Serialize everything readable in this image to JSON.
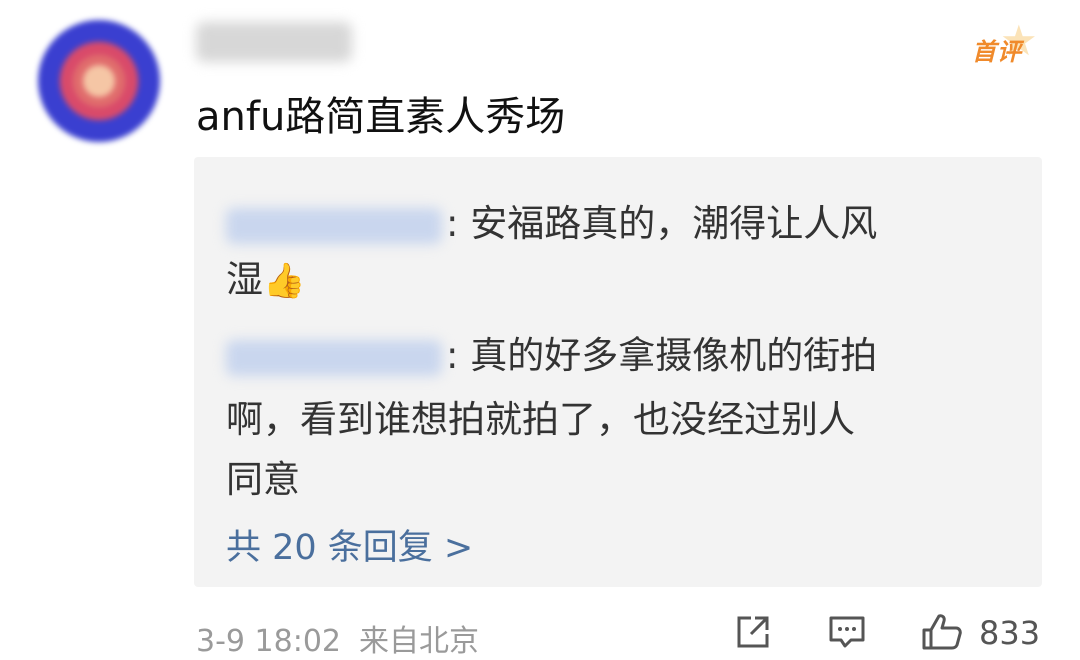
{
  "post": {
    "badge": "首评",
    "content": "anfu路简直素人秀场"
  },
  "replies": [
    {
      "text_line1": ": 安福路真的，潮得让人风",
      "text_line2": "湿",
      "emoji": "👍"
    },
    {
      "text_line1": ": 真的好多拿摄像机的街拍",
      "text_line2": "啊，看到谁想拍就拍了，也没经过别人",
      "text_line3": "同意"
    }
  ],
  "more_replies": "共 20 条回复 >",
  "footer": {
    "date": "3-9 18:02",
    "location": "来自北京",
    "like_count": "833"
  },
  "icons": [
    "share-icon",
    "comment-icon",
    "thumbs-up-icon"
  ],
  "colors": {
    "link": "#4a6f9d",
    "badge": "#f08a2b",
    "reply_bg": "#f3f3f3"
  }
}
